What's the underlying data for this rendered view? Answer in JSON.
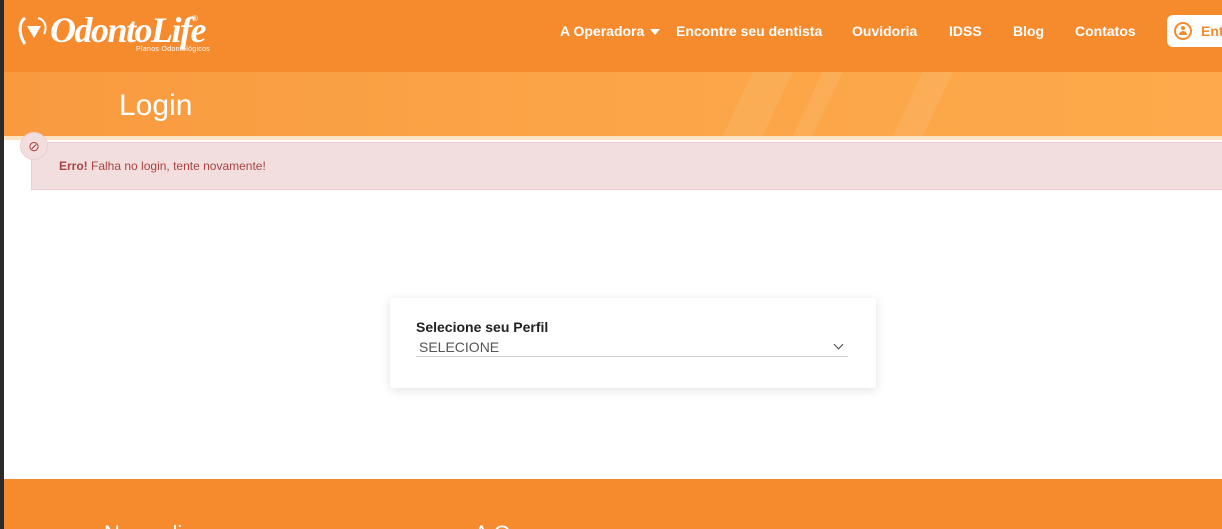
{
  "header": {
    "logo": {
      "wordmark": "OdontoLife",
      "registered": "®",
      "tagline": "Planos Odontológicos"
    },
    "nav": [
      {
        "label": "A Operadora",
        "has_dropdown": true
      },
      {
        "label": "Encontre seu dentista"
      },
      {
        "label": "Ouvidoria"
      },
      {
        "label": "IDSS"
      },
      {
        "label": "Blog"
      },
      {
        "label": "Contatos"
      }
    ],
    "enter_button": {
      "label": "Entrar",
      "icon": "user-circle-icon"
    }
  },
  "banner": {
    "title": "Login"
  },
  "alert": {
    "icon": "ban-icon",
    "title": "Erro!",
    "message": "Falha no login, tente novamente!"
  },
  "profile_card": {
    "label": "Selecione seu Perfil",
    "select_value": "SELECIONE"
  },
  "footer": {
    "text_left": "Nossa li...",
    "text_right": "A Opera..."
  },
  "colors": {
    "brand_orange": "#f68b2e",
    "alert_bg": "#f2dede",
    "alert_text": "#a94442"
  }
}
